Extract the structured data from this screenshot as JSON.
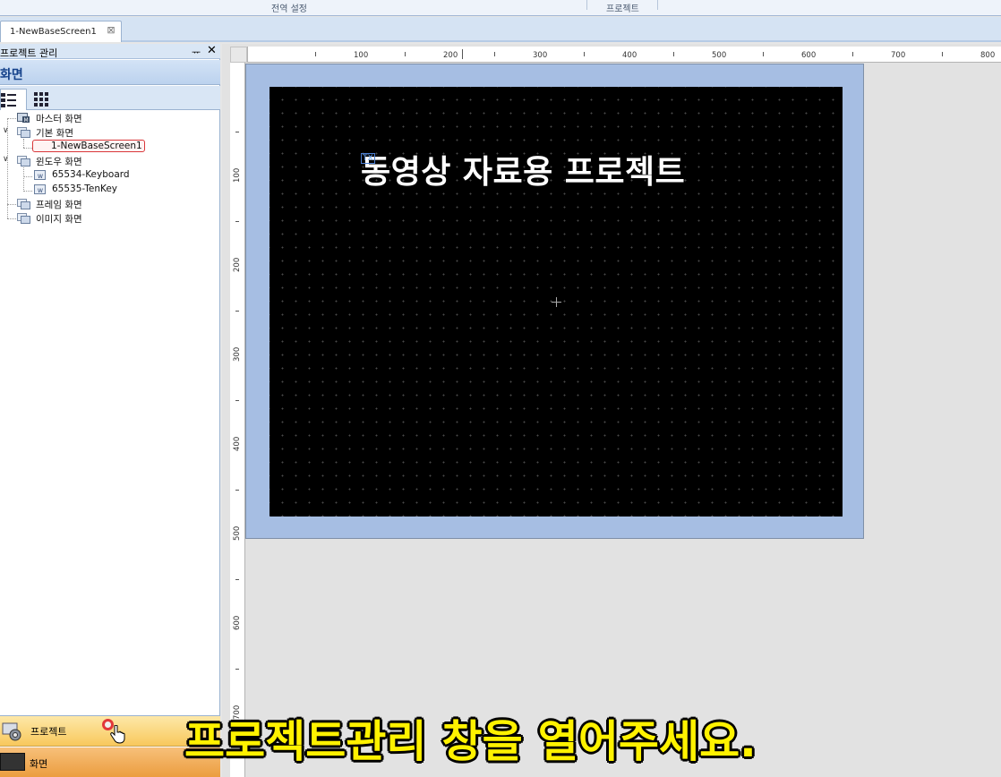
{
  "ribbon": {
    "group_labels": [
      "전역 설정",
      "프로젝트"
    ]
  },
  "document_tabs": [
    {
      "label": "1-NewBaseScreen1",
      "active": true
    }
  ],
  "project_panel": {
    "title": "프로젝트 관리",
    "pin_icon": "pin-icon",
    "close_icon": "close-icon",
    "section_title": "화면",
    "view_tabs": [
      "tree-view-icon",
      "grid-view-icon"
    ],
    "tree": [
      {
        "label": "마스터 화면",
        "icon": "master-screen-icon",
        "level": 0
      },
      {
        "label": "기본 화면",
        "icon": "folder-screen-icon",
        "level": 0,
        "expanded": true
      },
      {
        "label": "1-NewBaseScreen1",
        "icon": "base-screen-icon",
        "level": 1,
        "selected": true
      },
      {
        "label": "윈도우 화면",
        "icon": "folder-screen-icon",
        "level": 0,
        "expanded": true
      },
      {
        "label": "65534-Keyboard",
        "icon": "window-screen-icon",
        "level": 1
      },
      {
        "label": "65535-TenKey",
        "icon": "window-screen-icon",
        "level": 1
      },
      {
        "label": "프레임 화면",
        "icon": "folder-screen-icon",
        "level": 0
      },
      {
        "label": "이미지 화면",
        "icon": "folder-screen-icon",
        "level": 0
      }
    ],
    "bottom_buttons": [
      {
        "label": "프로젝트",
        "icon": "gear-icon"
      },
      {
        "label": "화면",
        "icon": "screen-icon"
      }
    ]
  },
  "editor": {
    "ruler_top_labels": [
      "100",
      "200",
      "300",
      "400",
      "500",
      "600",
      "700",
      "800"
    ],
    "ruler_left_labels": [
      "100",
      "200",
      "300",
      "400",
      "500",
      "600",
      "700"
    ],
    "canvas_text": "동영상 자료용 프로젝트",
    "text_object_tag": "TX",
    "colors": {
      "canvas": "#000000",
      "frame": "#a6bee3"
    }
  },
  "caption": "프로젝트관리 창을 열어주세요."
}
